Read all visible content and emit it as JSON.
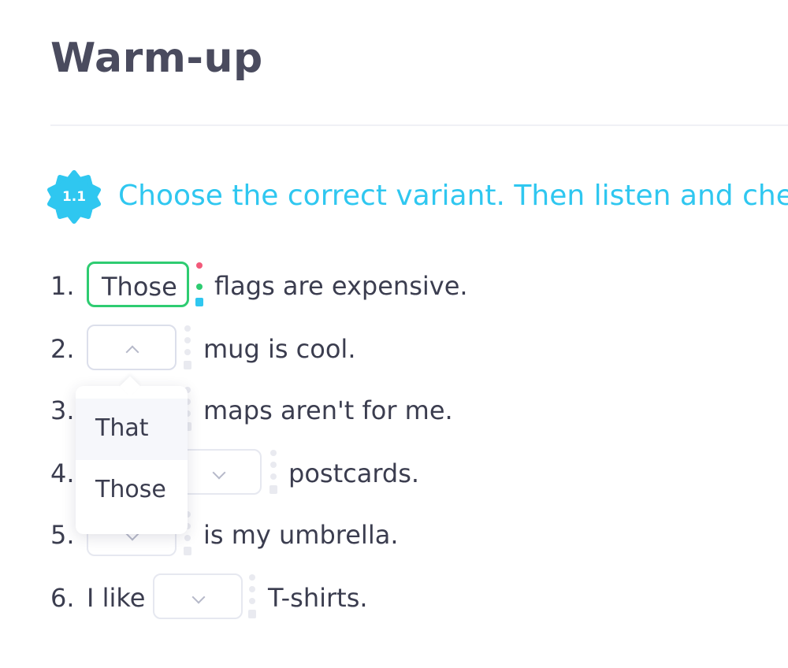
{
  "page": {
    "title": "Warm-up"
  },
  "task": {
    "badge": "1.1",
    "instruction": "Choose the correct variant. Then listen and che"
  },
  "exercises": [
    {
      "number": "1.",
      "lead": "",
      "answer": "Those",
      "rest": "flags are expensive."
    },
    {
      "number": "2.",
      "lead": "",
      "answer": "",
      "rest": "mug is cool."
    },
    {
      "number": "3.",
      "lead": "",
      "answer": "",
      "rest": "maps aren't for me."
    },
    {
      "number": "4.",
      "lead": "",
      "answer": "",
      "rest": "postcards."
    },
    {
      "number": "5.",
      "lead": "",
      "answer": "",
      "rest": "is my umbrella."
    },
    {
      "number": "6.",
      "lead": "I like",
      "answer": "",
      "rest": "T-shirts."
    }
  ],
  "dropdown": {
    "options": [
      "That",
      "Those"
    ]
  },
  "colors": {
    "accent": "#2fc7f0",
    "correct": "#2ecc71",
    "incorrect": "#f25a7a",
    "border": "#e6e8f0"
  }
}
